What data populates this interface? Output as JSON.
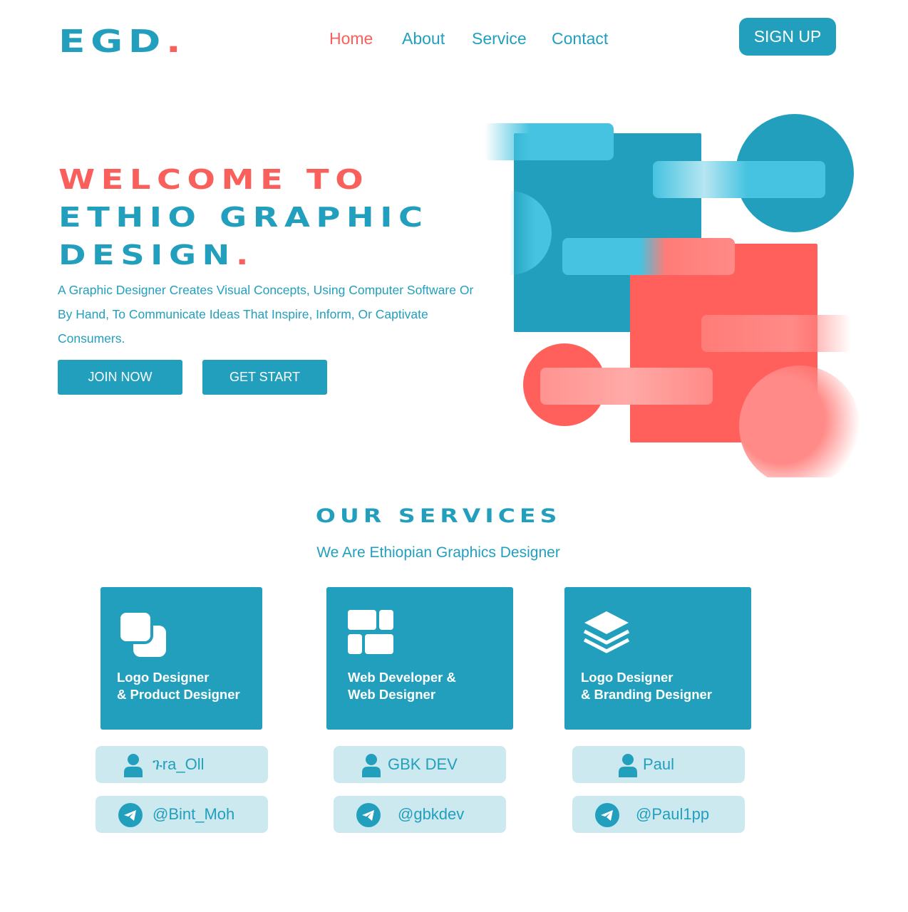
{
  "header": {
    "logo_text": "EGD",
    "logo_dot": ".",
    "nav": [
      "Home",
      "About",
      "Service",
      "Contact"
    ],
    "signup_label": "SIGN UP"
  },
  "hero": {
    "title_line1": "WELCOME TO",
    "title_line2": "ETHIO GRAPHIC",
    "title_line3": "DESIGN",
    "title_dot": ".",
    "description": "A Graphic Designer Creates Visual Concepts, Using Computer Software Or By Hand, To Communicate Ideas That Inspire, Inform, Or Captivate Consumers.",
    "join_label": "JOIN NOW",
    "start_label": "GET START"
  },
  "services": {
    "title": "OUR SERVICES",
    "subtitle": "We Are Ethiopian Graphics Designer",
    "cards": [
      {
        "label": "Logo Designer\n& Product Designer",
        "icon": "overlap-squares-icon",
        "name": "ጉra_Oll",
        "handle": "@Bint_Moh"
      },
      {
        "label": "Web Developer &\nWeb Designer",
        "icon": "grid-blocks-icon",
        "name": "GBK DEV",
        "handle": "@gbkdev"
      },
      {
        "label": "Logo Designer\n& Branding Designer",
        "icon": "layers-icon",
        "name": "Paul",
        "handle": "@Paul1pp"
      }
    ]
  },
  "colors": {
    "primary": "#229fbd",
    "accent": "#f9605b",
    "pill": "#cce9f0",
    "light_blue": "#45c3e0"
  }
}
